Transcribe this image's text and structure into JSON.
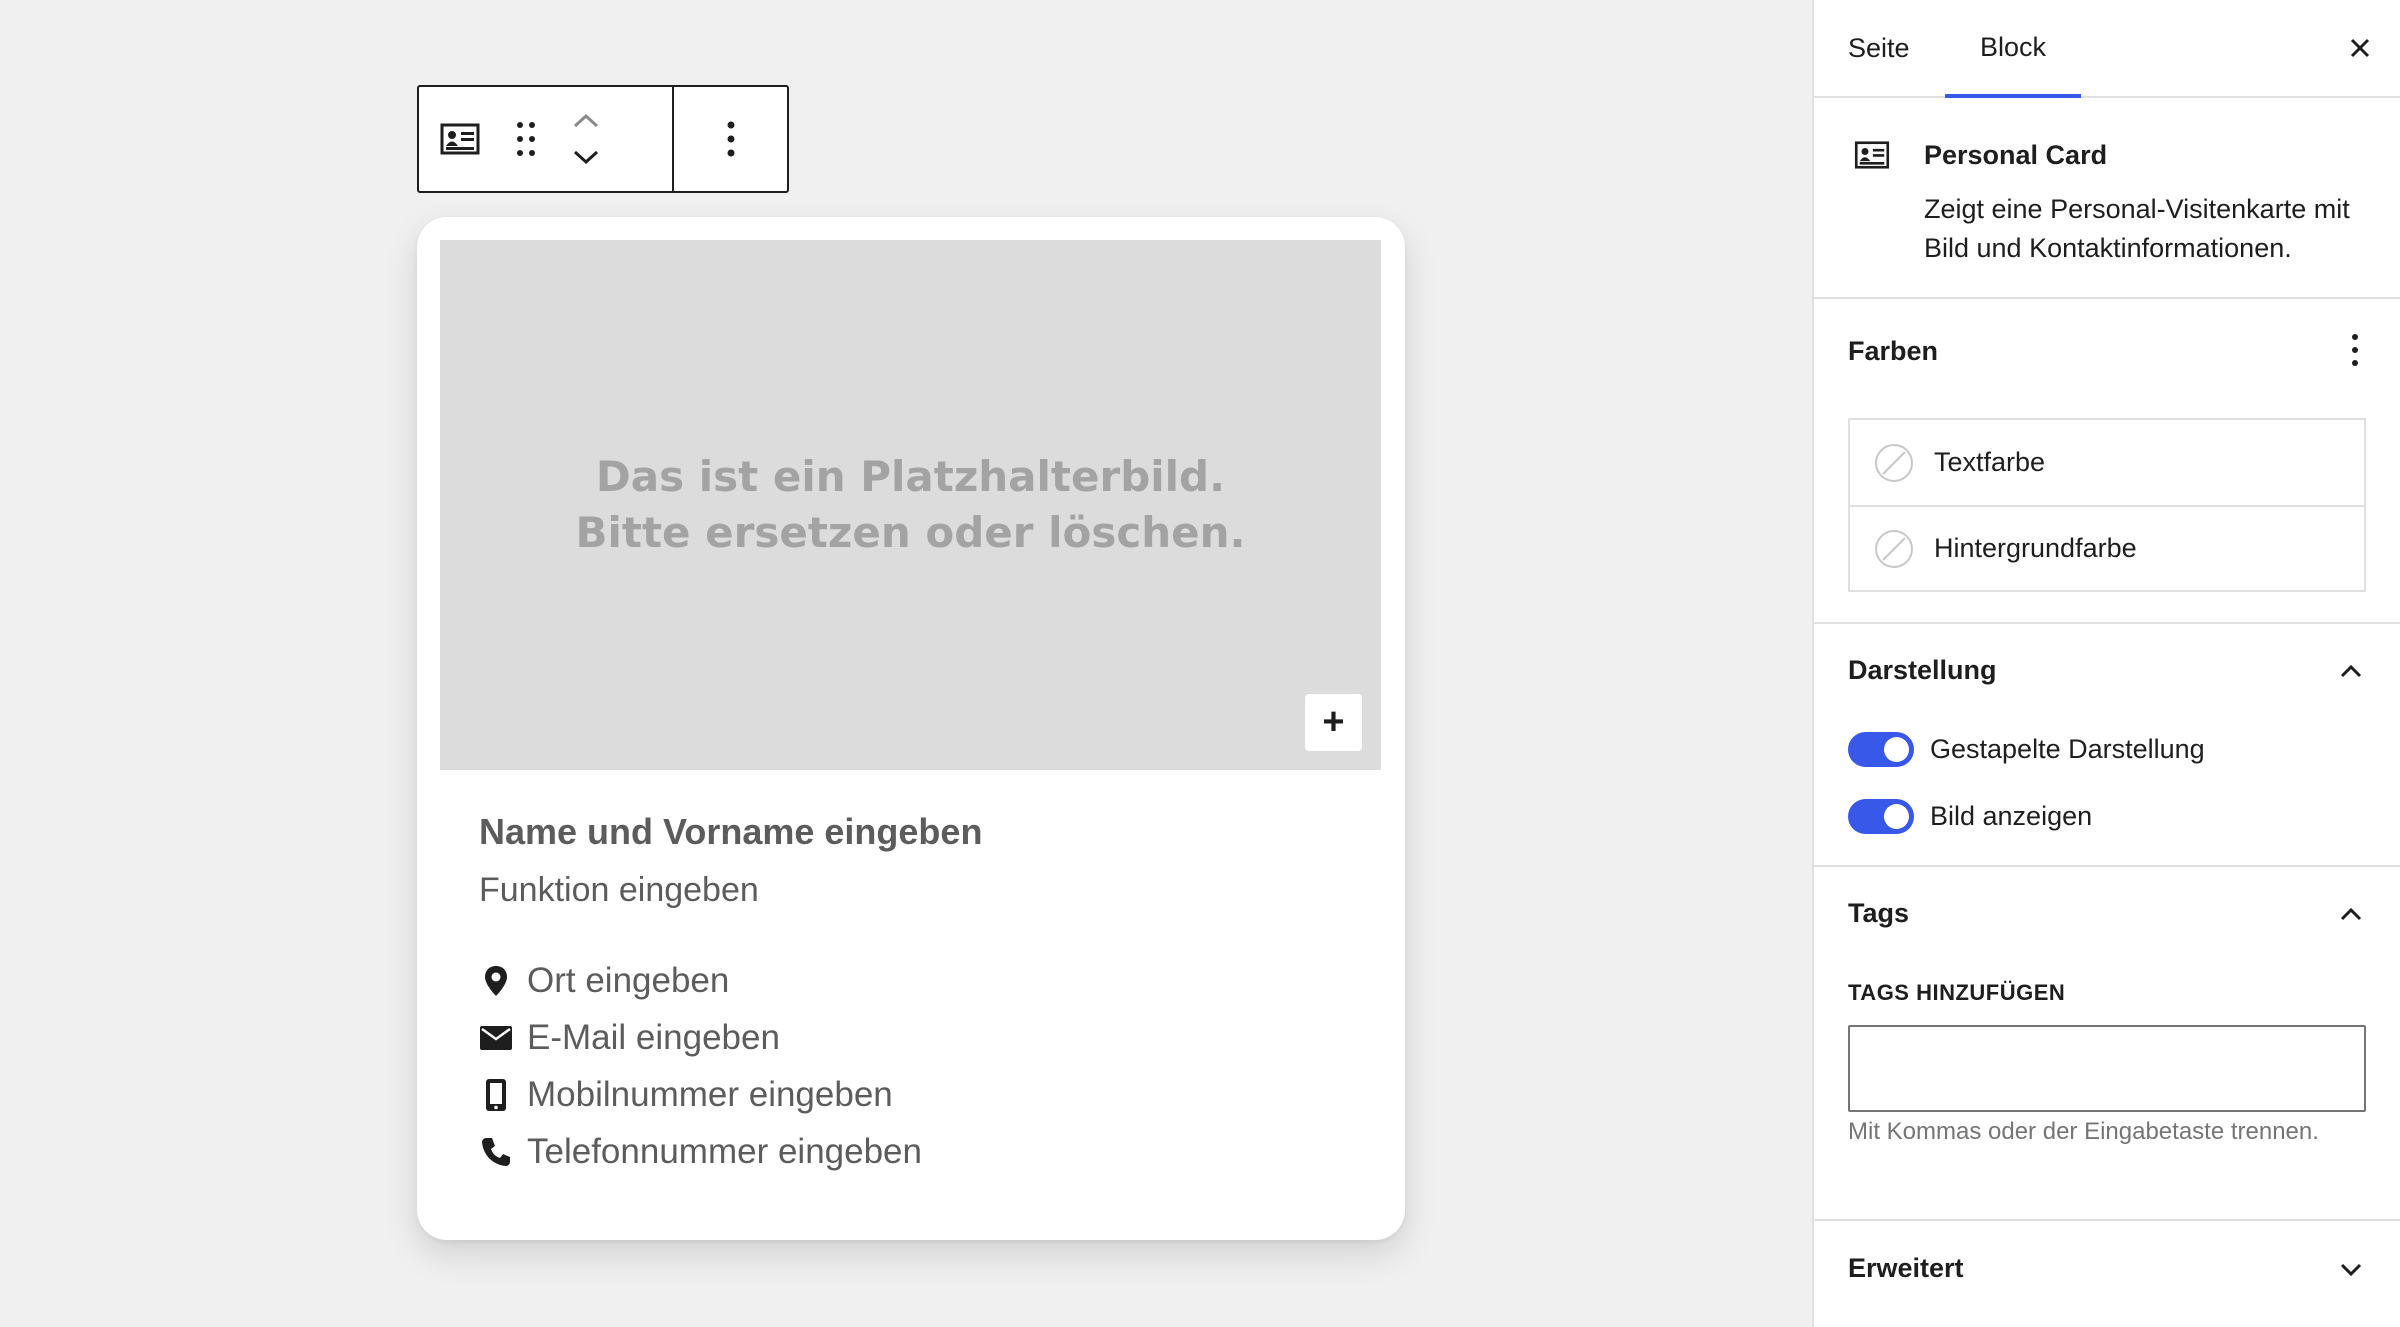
{
  "toolbar": {
    "block_type_icon": "personal-card-icon",
    "drag_icon": "drag-handle-icon",
    "move_up_icon": "chevron-up-icon",
    "move_down_icon": "chevron-down-icon",
    "more_icon": "more-vertical-icon"
  },
  "card": {
    "placeholder_line1": "Das ist ein Platzhalterbild.",
    "placeholder_line2": "Bitte ersetzen oder löschen.",
    "add_image_label": "+",
    "name": "Name und Vorname eingeben",
    "role": "Funktion eingeben",
    "contacts": [
      {
        "icon": "location-pin-icon",
        "label": "Ort eingeben"
      },
      {
        "icon": "email-icon",
        "label": "E-Mail eingeben"
      },
      {
        "icon": "mobile-phone-icon",
        "label": "Mobilnummer eingeben"
      },
      {
        "icon": "telephone-icon",
        "label": "Telefonnummer eingeben"
      }
    ]
  },
  "sidebar": {
    "tabs": [
      {
        "label": "Seite",
        "active": false
      },
      {
        "label": "Block",
        "active": true
      }
    ],
    "accent_color": "#3858e9",
    "block_card": {
      "title": "Personal Card",
      "description": "Zeigt eine Personal-Visitenkarte mit Bild und Kontaktinformationen."
    },
    "farben": {
      "title": "Farben",
      "items": [
        {
          "label": "Textfarbe"
        },
        {
          "label": "Hintergrundfarbe"
        }
      ]
    },
    "darstellung": {
      "title": "Darstellung",
      "expanded": true,
      "toggles": [
        {
          "label": "Gestapelte Darstellung",
          "on": true
        },
        {
          "label": "Bild anzeigen",
          "on": true
        }
      ]
    },
    "tags": {
      "title": "Tags",
      "expanded": true,
      "field_label": "TAGS HINZUFÜGEN",
      "value": "",
      "help": "Mit Kommas oder der Eingabetaste trennen."
    },
    "erweitert": {
      "title": "Erweitert",
      "expanded": false
    }
  }
}
